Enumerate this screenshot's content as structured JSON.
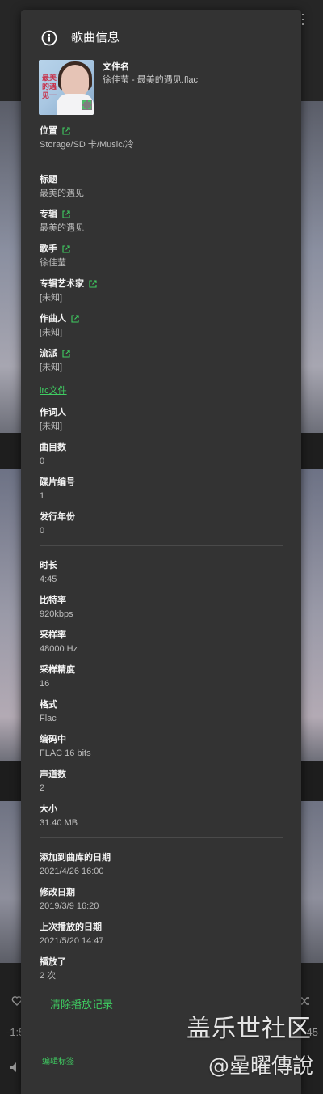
{
  "dialog": {
    "title": "歌曲信息",
    "file_name_label": "文件名",
    "file_name": "徐佳莹 - 最美的遇见.flac",
    "cover_title": "最美的遇见一",
    "location_label": "位置",
    "location": "Storage/SD 卡/Music/冷",
    "title_label": "标题",
    "title_value": "最美的遇见",
    "album_label": "专辑",
    "album": "最美的遇见",
    "artist_label": "歌手",
    "artist": "徐佳莹",
    "album_artist_label": "专辑艺术家",
    "album_artist": "[未知]",
    "composer_label": "作曲人",
    "composer": "[未知]",
    "genre_label": "流派",
    "genre": "[未知]",
    "lrc_link": "lrc文件",
    "lyricist_label": "作词人",
    "lyricist": "[未知]",
    "track_label": "曲目数",
    "track": "0",
    "disc_label": "碟片编号",
    "disc": "1",
    "year_label": "发行年份",
    "year": "0",
    "duration_label": "时长",
    "duration": "4:45",
    "bitrate_label": "比特率",
    "bitrate": "920kbps",
    "samplerate_label": "采样率",
    "samplerate": "48000 Hz",
    "bitdepth_label": "采样精度",
    "bitdepth": "16",
    "format_label": "格式",
    "format": "Flac",
    "encoding_label": "编码中",
    "encoding": "FLAC 16 bits",
    "channels_label": "声道数",
    "channels": "2",
    "size_label": "大小",
    "size": "31.40 MB",
    "added_label": "添加到曲库的日期",
    "added": "2021/4/26 16:00",
    "modified_label": "修改日期",
    "modified": "2019/3/9 16:20",
    "lastplayed_label": "上次播放的日期",
    "lastplayed": "2021/5/20 14:47",
    "playcount_label": "播放了",
    "playcount": "2 次",
    "clear_history": "清除播放记录",
    "edit_tags": "编辑标签"
  },
  "background": {
    "time_left": "-1:5",
    "time_right": "45"
  },
  "watermark": {
    "line1": "盖乐世社区",
    "line2": "@曐曜傳說"
  },
  "colors": {
    "dialog_bg": "#333333",
    "accent_green": "#3fce62",
    "text_primary": "#f2f2f2",
    "text_secondary": "#bdbdbd"
  },
  "icons": {
    "header": "info-icon",
    "external": "external-link-icon",
    "expand": "expand-icon",
    "overflow": "more-vert-icon"
  }
}
